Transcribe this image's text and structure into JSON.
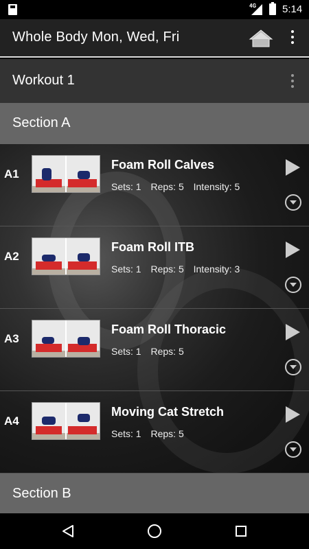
{
  "status_bar": {
    "network": "4G",
    "time": "5:14"
  },
  "action_bar": {
    "title": "Whole Body Mon, Wed, Fri"
  },
  "workout": {
    "label": "Workout 1"
  },
  "sections": [
    {
      "label": "Section A"
    },
    {
      "label": "Section B"
    }
  ],
  "exercises": [
    {
      "code": "A1",
      "name": "Foam Roll Calves",
      "sets": "Sets: 1",
      "reps": "Reps: 5",
      "intensity": "Intensity: 5"
    },
    {
      "code": "A2",
      "name": "Foam Roll ITB",
      "sets": "Sets: 1",
      "reps": "Reps: 5",
      "intensity": "Intensity: 3"
    },
    {
      "code": "A3",
      "name": "Foam Roll Thoracic",
      "sets": "Sets: 1",
      "reps": "Reps: 5",
      "intensity": ""
    },
    {
      "code": "A4",
      "name": "Moving Cat Stretch",
      "sets": "Sets: 1",
      "reps": "Reps: 5",
      "intensity": ""
    }
  ],
  "colors": {
    "action_bar_bg": "#222222",
    "workout_bg": "#333333",
    "section_bg": "#666666",
    "mat_red": "#d42b2b"
  },
  "icons": {
    "sd_card": "sd-card-icon",
    "signal": "signal-icon",
    "battery": "battery-icon",
    "home": "home-icon",
    "overflow": "overflow-menu-icon",
    "play": "play-icon",
    "expand": "expand-circle-icon",
    "back": "back-icon",
    "home_nav": "home-circle-icon",
    "recents": "recents-icon"
  }
}
